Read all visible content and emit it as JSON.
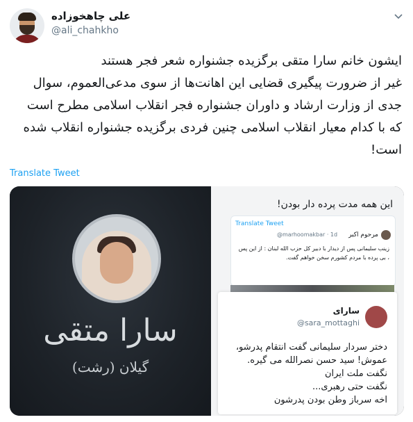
{
  "author": {
    "display_name": "علی چاهخوزاده",
    "handle": "@ali_chahkho"
  },
  "tweet": {
    "lines": [
      "ایشون خانم سارا متقی برگزیده جشنواره شعر فجر هستند",
      "غیر از ضرورت پیگیری قضایی این اهانت‌ها از سوی مدعی‌العموم، سوال",
      "جدی از وزارت ارشاد و داوران جشنواره فجر انقلاب اسلامی مطرح است",
      "که با کدام معیار انقلاب اسلامی چنین فردی برگزیده جشنواره انقلاب شده",
      "است!"
    ],
    "translate_label": "Translate Tweet"
  },
  "media": {
    "left": {
      "name": "سارا متقی",
      "subtitle": "گیلان (رشت)"
    },
    "right": {
      "header_text": "این همه مدت پرده دار بودن!",
      "inner_translate": "Translate Tweet",
      "inner_name": "مرحوم اکبر",
      "inner_handle": "@marhoomakbar · 1d",
      "inner_text": "زینب سلیمانی پس از دیدار با دبیر کل حزب الله لبنان : از این پس ، بی پرده با مردم کشورم سخن خواهم گفت.",
      "quote_name": "سارای",
      "quote_handle": "@sara_mottaghi",
      "quote_lines": [
        "دختر سردار سلیمانی گفت انتقام پدرشو،",
        "عموش! سید حسن نصرالله می گیره.",
        "نگفت ملت ایران",
        "نگفت حتی رهبری...",
        "اخه سرباز وطن بودن پدرشون"
      ]
    }
  },
  "colors": {
    "link": "#1da1f2",
    "text": "#14171a",
    "secondary": "#657786"
  },
  "icons": {
    "menu": "chevron-down-icon"
  }
}
